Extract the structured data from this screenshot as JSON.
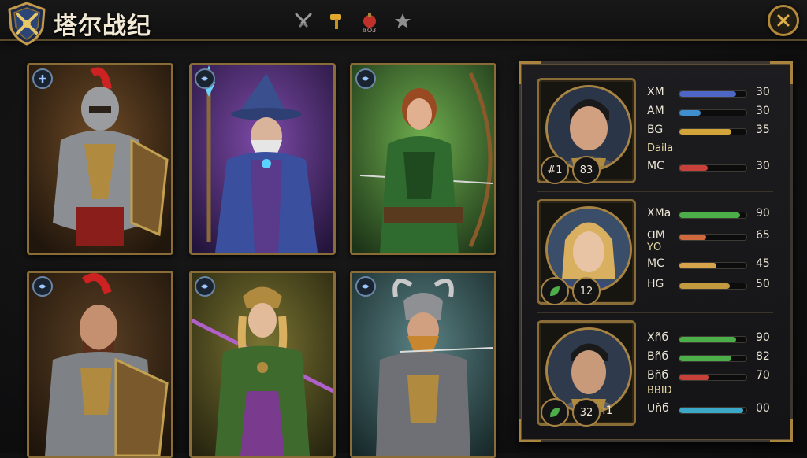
{
  "app": {
    "title": "塔尔战纪"
  },
  "tabs": [
    {
      "icon": "crossed-swords-icon"
    },
    {
      "icon": "hammer-icon"
    },
    {
      "icon": "potion-icon",
      "caption": "ßÔ3"
    },
    {
      "icon": "star-icon"
    }
  ],
  "colors": {
    "gold": "#b48a3a",
    "frame": "#8a6d36"
  },
  "cards": [
    {
      "name": "knight-red-plume",
      "bg": [
        "#5a3f22",
        "#2a1c10"
      ],
      "badge_icon": "plus-icon"
    },
    {
      "name": "wizard",
      "bg": [
        "#6a3f8f",
        "#2c1a44"
      ],
      "badge_icon": "fish-icon"
    },
    {
      "name": "archer",
      "bg": [
        "#4f8a3a",
        "#1f3a1a"
      ],
      "badge_icon": "fish-icon"
    },
    {
      "name": "warrior-shield",
      "bg": [
        "#4a3522",
        "#241a10"
      ],
      "badge_icon": "fish-icon"
    },
    {
      "name": "valkyrie-spear",
      "bg": [
        "#6e6a2e",
        "#2c2a14"
      ],
      "badge_icon": "fish-icon"
    },
    {
      "name": "dwarf-archer",
      "bg": [
        "#4b6f70",
        "#1d2e30"
      ],
      "badge_icon": "fish-icon"
    }
  ],
  "heroes": [
    {
      "badge": "#1",
      "level": "83",
      "stats": [
        {
          "label": "ꓫM",
          "value": "30",
          "fill": 0.85,
          "color": "#4e67c6"
        },
        {
          "label": "AM",
          "value": "30",
          "fill": 0.32,
          "color": "#3f8fd0"
        },
        {
          "label": "BG",
          "value": "35",
          "fill": 0.78,
          "color": "#d2a43a"
        },
        {
          "label": "MC",
          "value": "30",
          "fill": 0.42,
          "color": "#c8403a"
        }
      ],
      "extra": "Daila"
    },
    {
      "badge_icon": "leaf-icon",
      "level": "12",
      "stats": [
        {
          "label": "XMa",
          "value": "90",
          "fill": 0.9,
          "color": "#4bae48"
        },
        {
          "label": "ꓷM",
          "value": "65",
          "fill": 0.4,
          "color": "#d06a3e"
        },
        {
          "label": "MC",
          "value": "45",
          "fill": 0.55,
          "color": "#d6a44a"
        },
        {
          "label": "HG",
          "value": "50",
          "fill": 0.75,
          "color": "#c49a3e"
        }
      ],
      "extra": "ꓬO"
    },
    {
      "badge_icon": "leaf-icon",
      "level": "32",
      "stats": [
        {
          "label": "Xñб",
          "value": "90",
          "fill": 0.85,
          "color": "#4bae48"
        },
        {
          "label": "Bñб",
          "value": "82",
          "fill": 0.78,
          "color": "#4bae48"
        },
        {
          "label": "Bñб",
          "value": "70",
          "fill": 0.45,
          "color": "#c8403a"
        },
        {
          "label": "ꓴñб",
          "value": "00",
          "fill": 0.95,
          "color": "#3aa8c6"
        }
      ],
      "extra": "BBID",
      "level_suffix": ":1"
    }
  ]
}
